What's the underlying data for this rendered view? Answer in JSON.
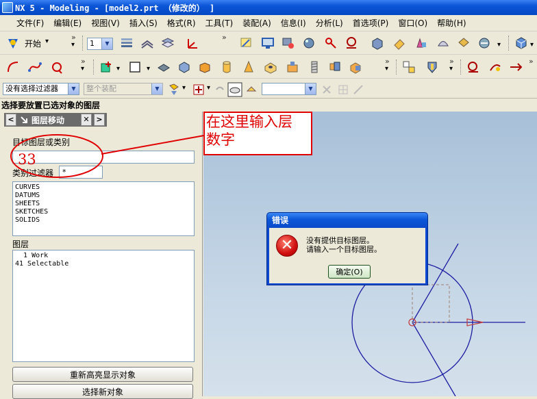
{
  "window": {
    "title": "NX 5 - Modeling - [model2.prt （修改的） ]"
  },
  "menubar": {
    "items": [
      "文件(F)",
      "编辑(E)",
      "视图(V)",
      "插入(S)",
      "格式(R)",
      "工具(T)",
      "装配(A)",
      "信息(I)",
      "分析(L)",
      "首选项(P)",
      "窗口(O)",
      "帮助(H)"
    ]
  },
  "toolbar": {
    "start_label": "开始",
    "layer_combo_value": "1"
  },
  "filterbar": {
    "type_filter": "没有选择过滤器",
    "scope_filter": "整个装配",
    "empty_combo": ""
  },
  "cue_line": "选择要放置已选对象的图层",
  "panel": {
    "title": "图层移动",
    "nav_prev": "<",
    "nav_next": ">",
    "close_symbol": "✕",
    "target_label": "目标图层或类别",
    "target_value": "",
    "category_filter_label": "类别过滤器",
    "category_filter_value": "*",
    "categories": [
      "CURVES",
      "DATUMS",
      "SHEETS",
      "SKETCHES",
      "SOLIDS"
    ],
    "layers_label": "图层",
    "layers": [
      "  1 Work",
      "41 Selectable"
    ],
    "highlight_button": "重新高亮显示对象",
    "reselect_button": "选择新对象"
  },
  "error_dialog": {
    "title": "错误",
    "line1": "没有提供目标图层。",
    "line2": "请输入一个目标图层。",
    "ok_label": "确定(O)"
  },
  "annotation": {
    "line1": "在这里输入层",
    "line2": "数字",
    "number": "33",
    "color": "#e00000"
  }
}
